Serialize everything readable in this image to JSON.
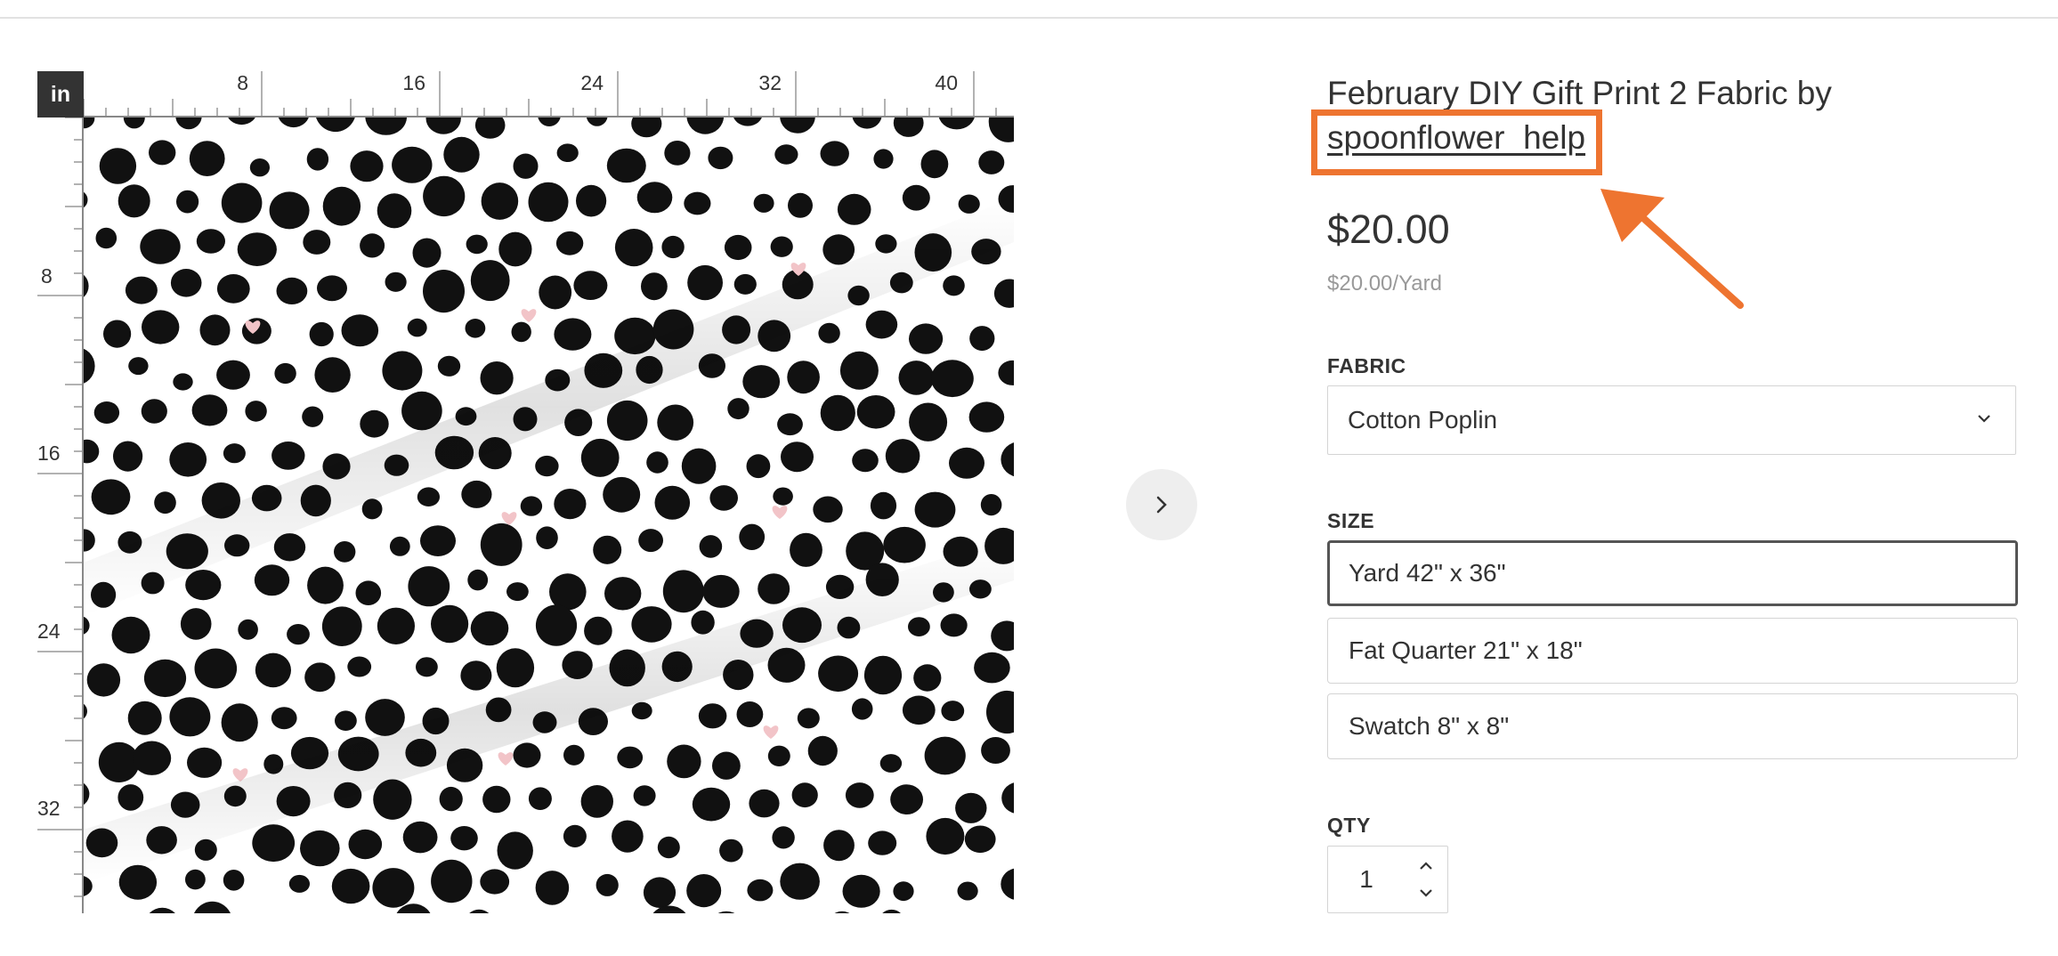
{
  "ruler": {
    "unit": "in",
    "top_ticks": [
      "8",
      "16",
      "24",
      "32",
      "40"
    ],
    "left_ticks": [
      "8",
      "16",
      "24",
      "32"
    ]
  },
  "product": {
    "title_prefix": "February DIY Gift Print 2 Fabric by",
    "designer": "spoonflower_help",
    "price": "$20.00",
    "unit_price": "$20.00/Yard"
  },
  "fabric": {
    "label": "FABRIC",
    "selected": "Cotton Poplin"
  },
  "size": {
    "label": "SIZE",
    "options": [
      {
        "label": "Yard 42\" x 36\"",
        "selected": true
      },
      {
        "label": "Fat Quarter 21\" x 18\"",
        "selected": false
      },
      {
        "label": "Swatch 8\" x 8\"",
        "selected": false
      }
    ]
  },
  "qty": {
    "label": "QTY",
    "value": "1"
  },
  "colors": {
    "highlight": "#ee7430",
    "dot": "#111111",
    "heart": "#f2c4c8",
    "text": "#333333"
  },
  "icons": {
    "next": "chevron-right-icon",
    "dropdown": "chevron-down-icon",
    "increment": "chevron-up-icon",
    "decrement": "chevron-down-icon",
    "annotation": "arrow-icon"
  }
}
